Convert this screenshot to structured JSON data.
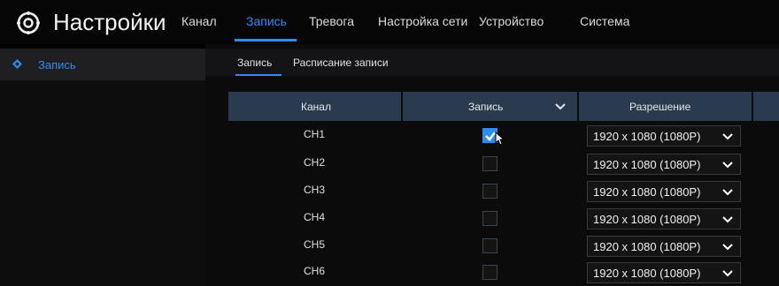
{
  "app": {
    "title": "Настройки",
    "logo_icon": "gear-icon"
  },
  "nav": {
    "tabs": [
      "Канал",
      "Запись",
      "Тревога",
      "Настройка сети",
      "Устройство",
      "Система"
    ],
    "active": "Запись"
  },
  "sidebar": {
    "items": [
      {
        "label": "Запись",
        "icon": "diamond-icon",
        "active": true
      }
    ]
  },
  "subtabs": {
    "items": [
      "Запись",
      "Расписание записи"
    ],
    "active": "Запись"
  },
  "table": {
    "headers": {
      "channel": "Канал",
      "record": "Запись",
      "resolution": "Разрешение"
    },
    "rows": [
      {
        "channel": "CH1",
        "record": true,
        "resolution": "1920 x 1080 (1080P)"
      },
      {
        "channel": "CH2",
        "record": false,
        "resolution": "1920 x 1080 (1080P)"
      },
      {
        "channel": "CH3",
        "record": false,
        "resolution": "1920 x 1080 (1080P)"
      },
      {
        "channel": "CH4",
        "record": false,
        "resolution": "1920 x 1080 (1080P)"
      },
      {
        "channel": "CH5",
        "record": false,
        "resolution": "1920 x 1080 (1080P)"
      },
      {
        "channel": "CH6",
        "record": false,
        "resolution": "1920 x 1080 (1080P)"
      }
    ]
  },
  "colors": {
    "accent": "#2d8cf0",
    "header_bg": "#2a3a4f",
    "background": "#000000"
  }
}
